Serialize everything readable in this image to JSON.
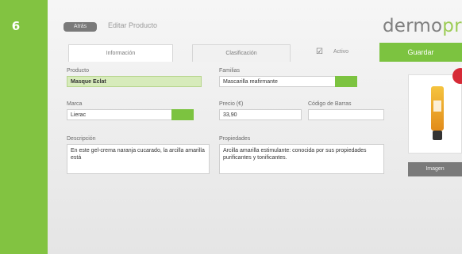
{
  "sidebar": {
    "step_number": "6"
  },
  "header": {
    "back_label": "Atrás",
    "title": "Editar Producto",
    "logo_prefix": "dermo",
    "logo_suffix": "prim"
  },
  "tabs": [
    {
      "label": "Información"
    },
    {
      "label": "Clasificación"
    }
  ],
  "toolbar": {
    "active_check": "☑",
    "active_label": "Activo",
    "save_label": "Guardar"
  },
  "form": {
    "producto_label": "Producto",
    "producto_value": "Masque Eclat",
    "familia_label": "Familias",
    "familia_value": "Mascarilla reafirmante",
    "marca_label": "Marca",
    "marca_value": "Lierac",
    "precio_label": "Precio (€)",
    "precio_value": "33,90",
    "codigo_label": "Código de Barras",
    "codigo_value": "",
    "descripcion_label": "Descripción",
    "descripcion_value": "En este gel-crema naranja cucarado, la arcilla amarilla está",
    "propiedades_label": "Propiedades",
    "propiedades_value": "Arcilla amarilla estimulante: conocida por sus propiedades purificantes y tonificantes."
  },
  "image_panel": {
    "upload_label": "Imagen"
  },
  "colors": {
    "accent": "#7cc340",
    "sidebar": "#82c341",
    "badge": "#d62a36"
  }
}
